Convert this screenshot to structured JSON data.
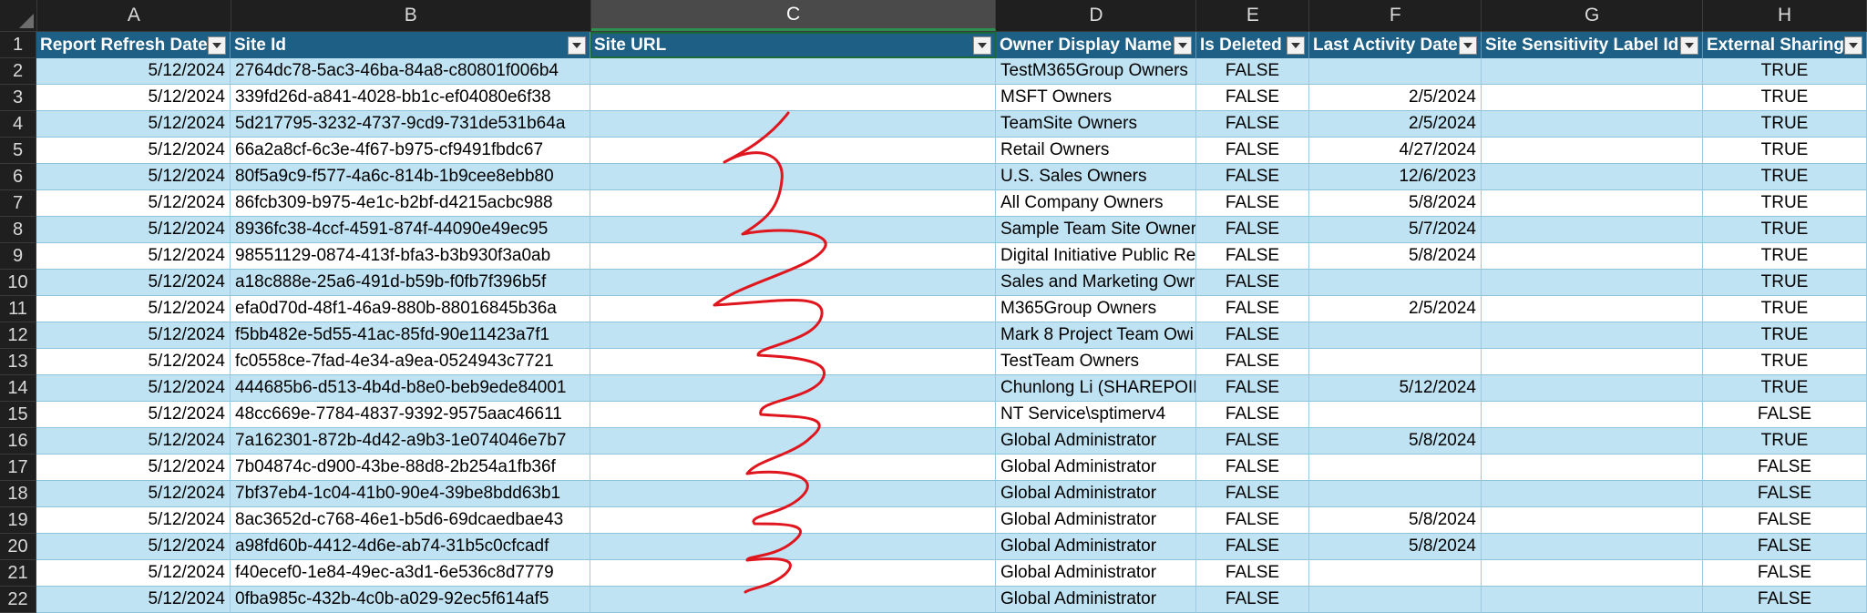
{
  "column_letters": [
    "A",
    "B",
    "C",
    "D",
    "E",
    "F",
    "G",
    "H"
  ],
  "selected_column": "C",
  "headers": [
    "Report Refresh Date",
    "Site Id",
    "Site URL",
    "Owner Display Name",
    "Is Deleted",
    "Last Activity Date",
    "Site Sensitivity Label Id",
    "External Sharing"
  ],
  "header_row_number": "1",
  "rows": [
    {
      "n": "2",
      "a": "5/12/2024",
      "b": "2764dc78-5ac3-46ba-84a8-c80801f006b4",
      "c": "",
      "d": "TestM365Group Owners",
      "e": "FALSE",
      "f": "",
      "g": "",
      "h": "TRUE"
    },
    {
      "n": "3",
      "a": "5/12/2024",
      "b": "339fd26d-a841-4028-bb1c-ef04080e6f38",
      "c": "",
      "d": "MSFT Owners",
      "e": "FALSE",
      "f": "2/5/2024",
      "g": "",
      "h": "TRUE"
    },
    {
      "n": "4",
      "a": "5/12/2024",
      "b": "5d217795-3232-4737-9cd9-731de531b64a",
      "c": "",
      "d": "TeamSite Owners",
      "e": "FALSE",
      "f": "2/5/2024",
      "g": "",
      "h": "TRUE"
    },
    {
      "n": "5",
      "a": "5/12/2024",
      "b": "66a2a8cf-6c3e-4f67-b975-cf9491fbdc67",
      "c": "",
      "d": "Retail Owners",
      "e": "FALSE",
      "f": "4/27/2024",
      "g": "",
      "h": "TRUE"
    },
    {
      "n": "6",
      "a": "5/12/2024",
      "b": "80f5a9c9-f577-4a6c-814b-1b9cee8ebb80",
      "c": "",
      "d": "U.S. Sales Owners",
      "e": "FALSE",
      "f": "12/6/2023",
      "g": "",
      "h": "TRUE"
    },
    {
      "n": "7",
      "a": "5/12/2024",
      "b": "86fcb309-b975-4e1c-b2bf-d4215acbc988",
      "c": "",
      "d": "All Company Owners",
      "e": "FALSE",
      "f": "5/8/2024",
      "g": "",
      "h": "TRUE"
    },
    {
      "n": "8",
      "a": "5/12/2024",
      "b": "8936fc38-4ccf-4591-874f-44090e49ec95",
      "c": "",
      "d": "Sample Team Site Owner",
      "e": "FALSE",
      "f": "5/7/2024",
      "g": "",
      "h": "TRUE"
    },
    {
      "n": "9",
      "a": "5/12/2024",
      "b": "98551129-0874-413f-bfa3-b3b930f3a0ab",
      "c": "",
      "d": "Digital Initiative Public Re",
      "e": "FALSE",
      "f": "5/8/2024",
      "g": "",
      "h": "TRUE"
    },
    {
      "n": "10",
      "a": "5/12/2024",
      "b": "a18c888e-25a6-491d-b59b-f0fb7f396b5f",
      "c": "",
      "d": "Sales and Marketing Owr",
      "e": "FALSE",
      "f": "",
      "g": "",
      "h": "TRUE"
    },
    {
      "n": "11",
      "a": "5/12/2024",
      "b": "efa0d70d-48f1-46a9-880b-88016845b36a",
      "c": "",
      "d": "M365Group Owners",
      "e": "FALSE",
      "f": "2/5/2024",
      "g": "",
      "h": "TRUE"
    },
    {
      "n": "12",
      "a": "5/12/2024",
      "b": "f5bb482e-5d55-41ac-85fd-90e11423a7f1",
      "c": "",
      "d": "Mark 8 Project Team Owi",
      "e": "FALSE",
      "f": "",
      "g": "",
      "h": "TRUE"
    },
    {
      "n": "13",
      "a": "5/12/2024",
      "b": "fc0558ce-7fad-4e34-a9ea-0524943c7721",
      "c": "",
      "d": "TestTeam Owners",
      "e": "FALSE",
      "f": "",
      "g": "",
      "h": "TRUE"
    },
    {
      "n": "14",
      "a": "5/12/2024",
      "b": "444685b6-d513-4b4d-b8e0-beb9ede84001",
      "c": "",
      "d": "Chunlong Li (SHAREPOIN",
      "e": "FALSE",
      "f": "5/12/2024",
      "g": "",
      "h": "TRUE"
    },
    {
      "n": "15",
      "a": "5/12/2024",
      "b": "48cc669e-7784-4837-9392-9575aac46611",
      "c": "",
      "d": "NT Service\\sptimerv4",
      "e": "FALSE",
      "f": "",
      "g": "",
      "h": "FALSE"
    },
    {
      "n": "16",
      "a": "5/12/2024",
      "b": "7a162301-872b-4d42-a9b3-1e074046e7b7",
      "c": "",
      "d": "Global Administrator",
      "e": "FALSE",
      "f": "5/8/2024",
      "g": "",
      "h": "TRUE"
    },
    {
      "n": "17",
      "a": "5/12/2024",
      "b": "7b04874c-d900-43be-88d8-2b254a1fb36f",
      "c": "",
      "d": "Global Administrator",
      "e": "FALSE",
      "f": "",
      "g": "",
      "h": "FALSE"
    },
    {
      "n": "18",
      "a": "5/12/2024",
      "b": "7bf37eb4-1c04-41b0-90e4-39be8bdd63b1",
      "c": "",
      "d": "Global Administrator",
      "e": "FALSE",
      "f": "",
      "g": "",
      "h": "FALSE"
    },
    {
      "n": "19",
      "a": "5/12/2024",
      "b": "8ac3652d-c768-46e1-b5d6-69dcaedbae43",
      "c": "",
      "d": "Global Administrator",
      "e": "FALSE",
      "f": "5/8/2024",
      "g": "",
      "h": "FALSE"
    },
    {
      "n": "20",
      "a": "5/12/2024",
      "b": "a98fd60b-4412-4d6e-ab74-31b5c0cfcadf",
      "c": "",
      "d": "Global Administrator",
      "e": "FALSE",
      "f": "5/8/2024",
      "g": "",
      "h": "FALSE"
    },
    {
      "n": "21",
      "a": "5/12/2024",
      "b": "f40ecef0-1e84-49ec-a3d1-6e536c8d7779",
      "c": "",
      "d": "Global Administrator",
      "e": "FALSE",
      "f": "",
      "g": "",
      "h": "FALSE"
    },
    {
      "n": "22",
      "a": "5/12/2024",
      "b": "0fba985c-432b-4c0b-a029-92ec5f614af5",
      "c": "",
      "d": "Global Administrator",
      "e": "FALSE",
      "f": "",
      "g": "",
      "h": "FALSE"
    }
  ],
  "annotation": {
    "color": "#e0161f",
    "icon": "red-scribble-redaction"
  },
  "colors": {
    "header_fill": "#1e5f86",
    "band_fill": "#bfe3f3",
    "selection_border": "#2f8f4e"
  }
}
